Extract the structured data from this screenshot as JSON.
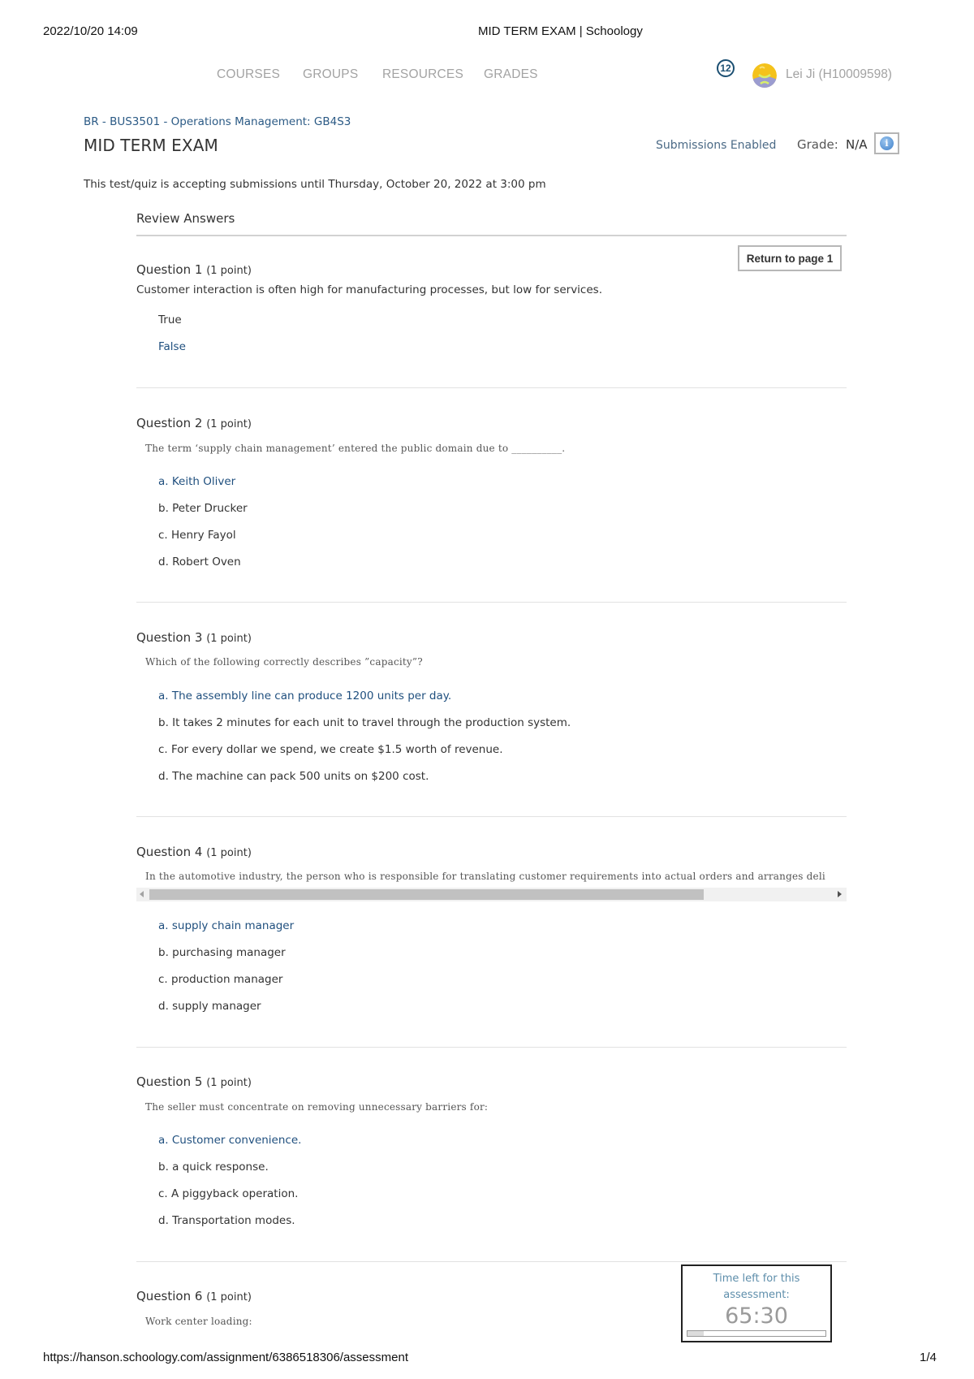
{
  "print_header": {
    "datetime": "2022/10/20 14:09",
    "page_title": "MID TERM EXAM | Schoology"
  },
  "nav": {
    "items": [
      {
        "label": "COURSES"
      },
      {
        "label": "GROUPS"
      },
      {
        "label": "RESOURCES"
      },
      {
        "label": "GRADES"
      }
    ],
    "notification_count": "12",
    "user_name": "Lei Ji (H10009598)"
  },
  "course": {
    "breadcrumb": "BR - BUS3501 - Operations Management: GB4S3",
    "title": "MID TERM EXAM",
    "submissions_status": "Submissions Enabled",
    "grade_label": "Grade:",
    "grade_value": "N/A",
    "info_icon": "info-icon",
    "accepting_text": "This test/quiz is accepting submissions until Thursday, October 20, 2022 at 3:00 pm"
  },
  "review": {
    "heading": "Review Answers",
    "return_button": "Return to page 1"
  },
  "questions": [
    {
      "title": "Question 1",
      "points": "(1 point)",
      "text": "Customer interaction is often high for manufacturing processes, but low for services.",
      "options": [
        "True",
        "False"
      ],
      "selected_index": 1
    },
    {
      "title": "Question 2",
      "points": "(1 point)",
      "text": "The term ‘supply chain management’ entered the public domain due to __________.",
      "options": [
        "a. Keith Oliver",
        "b. Peter Drucker",
        "c. Henry Fayol",
        "d. Robert Oven"
      ],
      "selected_index": 0
    },
    {
      "title": "Question 3",
      "points": "(1 point)",
      "text": "Which of the following correctly describes ”capacity”?",
      "options": [
        "a. The assembly line can produce 1200 units per day.",
        "b. It takes 2 minutes for each unit to travel through the production system.",
        "c. For every dollar we spend, we create $1.5 worth of revenue.",
        "d. The machine can pack 500 units on $200 cost."
      ],
      "selected_index": 0
    },
    {
      "title": "Question 4",
      "points": "(1 point)",
      "text": "In the automotive industry, the person who is responsible for translating customer requirements into actual orders and arranges deli",
      "scroll_position_fraction": 0.0,
      "scroll_visible_fraction": 0.81,
      "options": [
        "a. supply chain manager",
        "b. purchasing manager",
        "c. production manager",
        "d. supply manager"
      ],
      "selected_index": 0
    },
    {
      "title": "Question 5",
      "points": "(1 point)",
      "text": "The seller must concentrate on removing unnecessary barriers for:",
      "options": [
        "a. Customer convenience.",
        "b. a quick response.",
        "c. A piggyback operation.",
        "d. Transportation modes."
      ],
      "selected_index": 0
    },
    {
      "title": "Question 6",
      "points": "(1 point)",
      "text": "Work center loading:"
    }
  ],
  "timer": {
    "label_line1": "Time left for this",
    "label_line2": "assessment:",
    "value": "65:30",
    "elapsed_fraction": 0.12
  },
  "print_footer": {
    "url": "https://hanson.schoology.com/assignment/6386518306/assessment",
    "page": "1/4"
  }
}
